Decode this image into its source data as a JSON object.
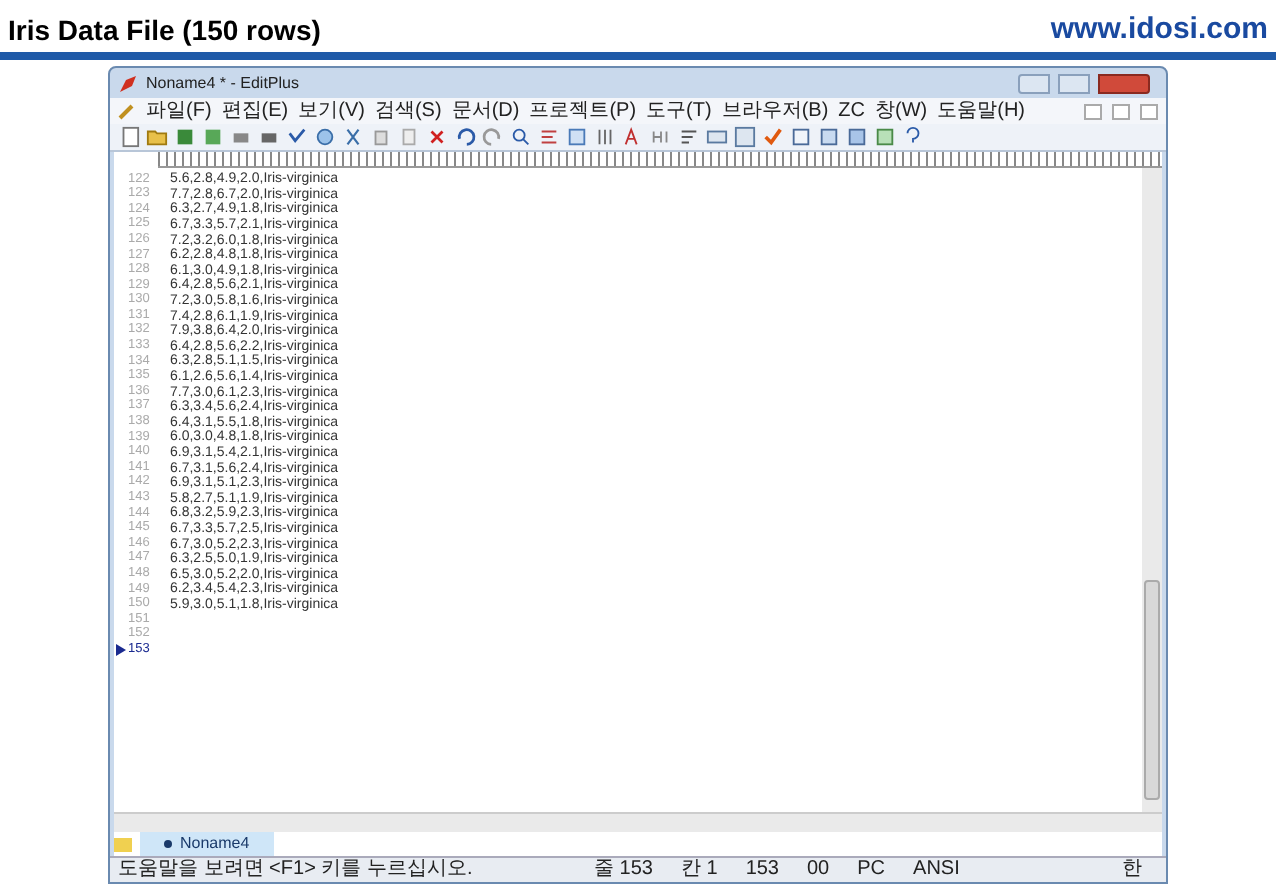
{
  "slide": {
    "title": "Iris Data File (150 rows)",
    "site": "www.idosi.com"
  },
  "window": {
    "title": "Noname4 * - EditPlus"
  },
  "menu": [
    "파일(F)",
    "편집(E)",
    "보기(V)",
    "검색(S)",
    "문서(D)",
    "프로젝트(P)",
    "도구(T)",
    "브라우저(B)",
    "ZC",
    "창(W)",
    "도움말(H)"
  ],
  "editor": {
    "lines": [
      {
        "number": "122",
        "text": "5.6,2.8,4.9,2.0,Iris-virginica",
        "selected": false
      },
      {
        "number": "123",
        "text": "7.7,2.8,6.7,2.0,Iris-virginica",
        "selected": false
      },
      {
        "number": "124",
        "text": "6.3,2.7,4.9,1.8,Iris-virginica",
        "selected": false
      },
      {
        "number": "125",
        "text": "6.7,3.3,5.7,2.1,Iris-virginica",
        "selected": false
      },
      {
        "number": "126",
        "text": "7.2,3.2,6.0,1.8,Iris-virginica",
        "selected": false
      },
      {
        "number": "127",
        "text": "6.2,2.8,4.8,1.8,Iris-virginica",
        "selected": false
      },
      {
        "number": "128",
        "text": "6.1,3.0,4.9,1.8,Iris-virginica",
        "selected": false
      },
      {
        "number": "129",
        "text": "6.4,2.8,5.6,2.1,Iris-virginica",
        "selected": false
      },
      {
        "number": "130",
        "text": "7.2,3.0,5.8,1.6,Iris-virginica",
        "selected": false
      },
      {
        "number": "131",
        "text": "7.4,2.8,6.1,1.9,Iris-virginica",
        "selected": false
      },
      {
        "number": "132",
        "text": "7.9,3.8,6.4,2.0,Iris-virginica",
        "selected": false
      },
      {
        "number": "133",
        "text": "6.4,2.8,5.6,2.2,Iris-virginica",
        "selected": false
      },
      {
        "number": "134",
        "text": "6.3,2.8,5.1,1.5,Iris-virginica",
        "selected": false
      },
      {
        "number": "135",
        "text": "6.1,2.6,5.6,1.4,Iris-virginica",
        "selected": false
      },
      {
        "number": "136",
        "text": "7.7,3.0,6.1,2.3,Iris-virginica",
        "selected": false
      },
      {
        "number": "137",
        "text": "6.3,3.4,5.6,2.4,Iris-virginica",
        "selected": false
      },
      {
        "number": "138",
        "text": "6.4,3.1,5.5,1.8,Iris-virginica",
        "selected": false
      },
      {
        "number": "139",
        "text": "6.0,3.0,4.8,1.8,Iris-virginica",
        "selected": false
      },
      {
        "number": "140",
        "text": "6.9,3.1,5.4,2.1,Iris-virginica",
        "selected": false
      },
      {
        "number": "141",
        "text": "6.7,3.1,5.6,2.4,Iris-virginica",
        "selected": false
      },
      {
        "number": "142",
        "text": "6.9,3.1,5.1,2.3,Iris-virginica",
        "selected": false
      },
      {
        "number": "143",
        "text": "5.8,2.7,5.1,1.9,Iris-virginica",
        "selected": false
      },
      {
        "number": "144",
        "text": "6.8,3.2,5.9,2.3,Iris-virginica",
        "selected": false
      },
      {
        "number": "145",
        "text": "6.7,3.3,5.7,2.5,Iris-virginica",
        "selected": false
      },
      {
        "number": "146",
        "text": "6.7,3.0,5.2,2.3,Iris-virginica",
        "selected": false
      },
      {
        "number": "147",
        "text": "6.3,2.5,5.0,1.9,Iris-virginica",
        "selected": false
      },
      {
        "number": "148",
        "text": "6.5,3.0,5.2,2.0,Iris-virginica",
        "selected": false
      },
      {
        "number": "149",
        "text": "6.2,3.4,5.4,2.3,Iris-virginica",
        "selected": false
      },
      {
        "number": "150",
        "text": "5.9,3.0,5.1,1.8,Iris-virginica",
        "selected": false
      },
      {
        "number": "151",
        "selected": false
      },
      {
        "number": "152",
        "selected": false
      },
      {
        "number": "153",
        "selected": true
      }
    ]
  },
  "document_tabs": [
    {
      "label": "Noname4",
      "selected": true
    }
  ],
  "status_bar": {
    "message": "도움말을 보려면 <F1> 키를 누르십시오.",
    "fields": [
      "줄 153",
      "칸 1",
      "153",
      "00",
      "PC",
      "ANSI"
    ],
    "ime": "한"
  }
}
